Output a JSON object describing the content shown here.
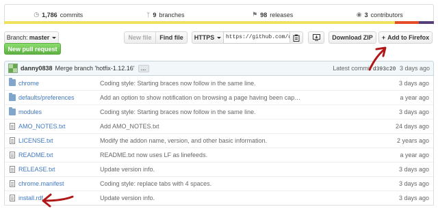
{
  "stats": {
    "commits_count": "1,786",
    "commits_label": "commits",
    "branches_count": "9",
    "branches_label": "branches",
    "releases_count": "98",
    "releases_label": "releases",
    "contributors_count": "3",
    "contributors_label": "contributors"
  },
  "colors": {
    "lang_bar": [
      "#f1e05a",
      "#e34c26",
      "#563d7c"
    ],
    "link": "#4078c0",
    "annotation_arrow": "#b01818"
  },
  "toolbar": {
    "branch_prefix": "Branch:",
    "branch_value": "master",
    "new_pull_request": "New pull request",
    "new_file": "New file",
    "find_file": "Find file",
    "https": "HTTPS",
    "clone_url": "https://github.com/d",
    "download_zip": "Download ZIP",
    "add_to_firefox": "Add to Firefox"
  },
  "commit": {
    "author": "danny0838",
    "message": "Merge branch 'hotfix-1.12.16'",
    "ellipsis": "…",
    "latest_label": "Latest commit",
    "sha": "d393c20",
    "age": "3 days ago"
  },
  "files": [
    {
      "type": "folder",
      "name": "chrome",
      "message": "Coding style: Starting braces now follow in the same line.",
      "age": "3 days ago"
    },
    {
      "type": "folder",
      "name": "defaults/preferences",
      "message": "Add an option to show notification on browsing a page having been cap…",
      "age": "a year ago"
    },
    {
      "type": "folder",
      "name": "modules",
      "message": "Coding style: Starting braces now follow in the same line.",
      "age": "3 days ago"
    },
    {
      "type": "file",
      "name": "AMO_NOTES.txt",
      "message": "Add AMO_NOTES.txt",
      "age": "24 days ago"
    },
    {
      "type": "file",
      "name": "LICENSE.txt",
      "message": "Modify the addon name, version, and other basic information.",
      "age": "2 years ago"
    },
    {
      "type": "file",
      "name": "README.txt",
      "message": "README.txt now uses LF as linefeeds.",
      "age": "a year ago"
    },
    {
      "type": "file",
      "name": "RELEASE.txt",
      "message": "Update version info.",
      "age": "3 days ago"
    },
    {
      "type": "file",
      "name": "chrome.manifest",
      "message": "Coding style: replace tabs with 4 spaces.",
      "age": "3 days ago"
    },
    {
      "type": "file",
      "name": "install.rdf",
      "message": "Update version info.",
      "age": "3 days ago"
    }
  ]
}
